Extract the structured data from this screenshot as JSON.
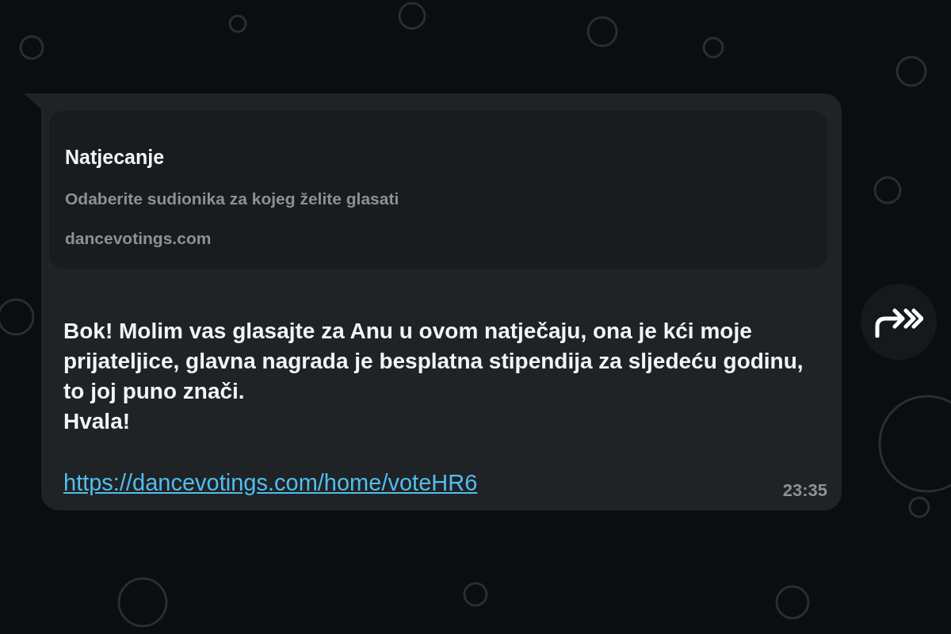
{
  "message": {
    "preview": {
      "title": "Natjecanje",
      "description": "Odaberite sudionika za kojeg želite glasati",
      "domain": "dancevotings.com"
    },
    "text": "Bok! Molim vas glasajte za Anu u ovom natječaju, ona je kći moje prijateljice, glavna nagrada je besplatna stipendija za sljedeću godinu, to joj puno znači.\nHvala!",
    "link": "https://dancevotings.com/home/voteHR6",
    "time": "23:35"
  }
}
